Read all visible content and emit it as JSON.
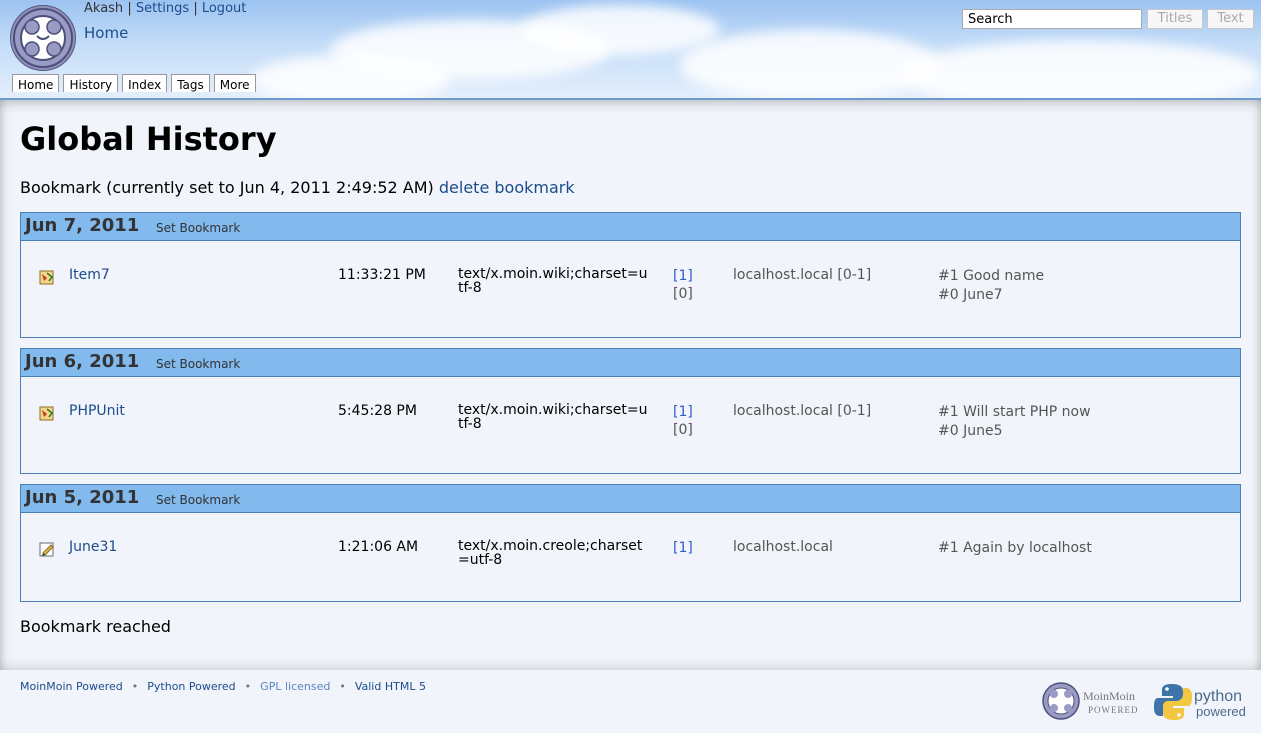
{
  "header": {
    "user": "Akash",
    "sep": "|",
    "settings": "Settings",
    "logout": "Logout",
    "home": "Home",
    "search_value": "Search",
    "titles_button": "Titles",
    "text_button": "Text",
    "tabs": [
      "Home",
      "History",
      "Index",
      "Tags",
      "More"
    ]
  },
  "main": {
    "title": "Global History",
    "bookmark_text": "Bookmark (currently set to Jun 4, 2011 2:49:52 AM)",
    "delete_bookmark": "delete bookmark",
    "set_bookmark": "Set Bookmark",
    "days": [
      {
        "date": "Jun 7, 2011",
        "name": "Item7",
        "time": "11:33:21 PM",
        "type": "text/x.moin.wiki;charset=utf-8",
        "rev_link": "[1]",
        "rev_other": "[0]",
        "host": "localhost.local [0-1]",
        "comment1": "#1 Good name",
        "comment2": "#0 June7",
        "icon": "page-diff-icon"
      },
      {
        "date": "Jun 6, 2011",
        "name": "PHPUnit",
        "time": "5:45:28 PM",
        "type": "text/x.moin.wiki;charset=utf-8",
        "rev_link": "[1]",
        "rev_other": "[0]",
        "host": "localhost.local [0-1]",
        "comment1": "#1 Will start PHP now",
        "comment2": "#0 June5",
        "icon": "page-diff-icon"
      },
      {
        "date": "Jun 5, 2011",
        "name": "June31",
        "time": "1:21:06 AM",
        "type": "text/x.moin.creole;charset=utf-8",
        "rev_link": "[1]",
        "host": "localhost.local",
        "comment1": "#1 Again by localhost",
        "icon": "page-new-icon"
      }
    ],
    "reached": "Bookmark reached"
  },
  "footer": {
    "links": [
      "MoinMoin Powered",
      "Python Powered",
      "GPL licensed",
      "Valid HTML 5"
    ],
    "bullet": "•",
    "moin_badge_1": "MoinMoin",
    "moin_badge_2": "POWERED",
    "python_badge_1": "python",
    "python_badge_2": "powered"
  },
  "colors": {
    "accent": "#82baee",
    "link": "#1b4d8c",
    "border": "#4a7fb8"
  }
}
